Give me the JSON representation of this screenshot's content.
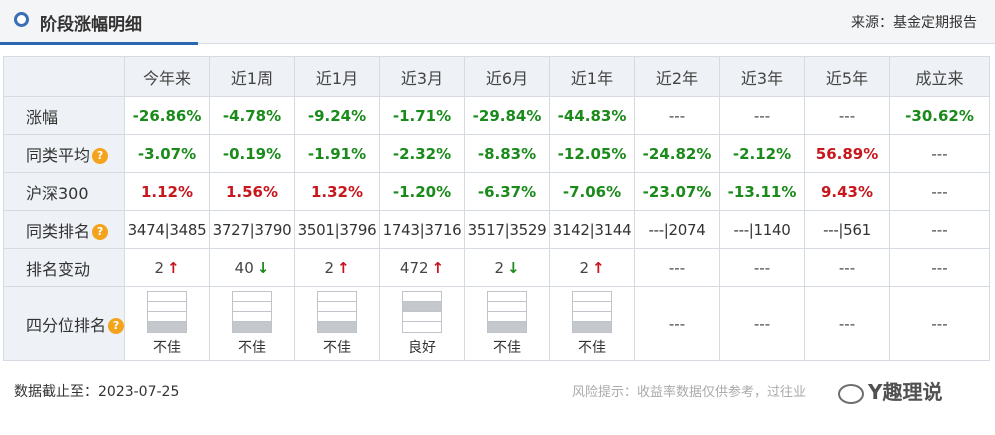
{
  "header": {
    "title": "阶段涨幅明细",
    "source": "来源：基金定期报告"
  },
  "columns": [
    "今年来",
    "近1周",
    "近1月",
    "近3月",
    "近6月",
    "近1年",
    "近2年",
    "近3年",
    "近5年",
    "成立来"
  ],
  "rows": {
    "change": {
      "label": "涨幅",
      "values": [
        "-26.86%",
        "-4.78%",
        "-9.24%",
        "-1.71%",
        "-29.84%",
        "-44.83%",
        "---",
        "---",
        "---",
        "-30.62%"
      ]
    },
    "peer_avg": {
      "label": "同类平均",
      "values": [
        "-3.07%",
        "-0.19%",
        "-1.91%",
        "-2.32%",
        "-8.83%",
        "-12.05%",
        "-24.82%",
        "-2.12%",
        "56.89%",
        "---"
      ]
    },
    "csi300": {
      "label": "沪深300",
      "values": [
        "1.12%",
        "1.56%",
        "1.32%",
        "-1.20%",
        "-6.37%",
        "-7.06%",
        "-23.07%",
        "-13.11%",
        "9.43%",
        "---"
      ]
    },
    "peer_rank": {
      "label": "同类排名",
      "values": [
        "3474|3485",
        "3727|3790",
        "3501|3796",
        "1743|3716",
        "3517|3529",
        "3142|3144",
        "---|2074",
        "---|1140",
        "---|561",
        "---"
      ]
    },
    "rank_change": {
      "label": "排名变动",
      "values": [
        "2",
        "40",
        "2",
        "472",
        "2",
        "2",
        "---",
        "---",
        "---",
        "---"
      ],
      "arrows": [
        "↑",
        "↓",
        "↑",
        "↑",
        "↓",
        "↑",
        "",
        "",
        "",
        ""
      ]
    },
    "quartile": {
      "label": "四分位排名",
      "labels": [
        "不佳",
        "不佳",
        "不佳",
        "良好",
        "不佳",
        "不佳"
      ],
      "filled_bar": [
        4,
        4,
        4,
        2,
        4,
        4
      ],
      "empty_text": "---"
    }
  },
  "icons": {
    "help": "?"
  },
  "colors": {
    "negative": "#1a8a1a",
    "positive": "#c8161d",
    "accent": "#2a66b2",
    "info_icon": "#f4a41c"
  },
  "footer": {
    "date": "数据截止至：2023-07-25",
    "risk": "风险提示：收益率数据仅供参考，过往业",
    "watermark": "Y趣理说"
  }
}
